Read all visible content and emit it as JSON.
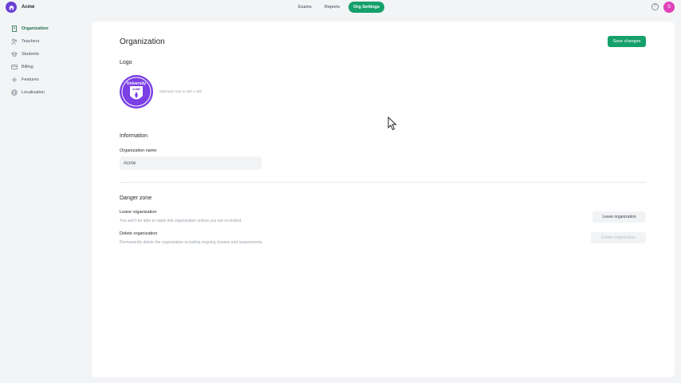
{
  "topbar": {
    "org_name": "Acme",
    "tabs": [
      {
        "label": "Exams"
      },
      {
        "label": "Reports"
      },
      {
        "label": "Org Settings",
        "active": true
      }
    ],
    "help_icon": "help-circle-icon",
    "avatar_initial": "S",
    "avatar_color": "#e040b8",
    "accent_color": "#16a06b"
  },
  "sidebar": {
    "items": [
      {
        "label": "Organization",
        "icon": "building-icon",
        "active": true
      },
      {
        "label": "Teachers",
        "icon": "users-icon"
      },
      {
        "label": "Students",
        "icon": "graduation-cap-icon"
      },
      {
        "label": "Billing",
        "icon": "credit-card-icon"
      },
      {
        "label": "Features",
        "icon": "sparkles-icon"
      },
      {
        "label": "Localization",
        "icon": "globe-icon"
      }
    ]
  },
  "main": {
    "title": "Organization",
    "save_label": "Save changes",
    "logo": {
      "heading": "Logo",
      "badge_top": "University",
      "badge_shield": "ACME",
      "hint": "Minimum size is 400 x 400"
    },
    "information": {
      "heading": "Information",
      "name_label": "Organization name",
      "name_value": "Acme"
    },
    "danger": {
      "heading": "Danger zone",
      "leave_title": "Leave organization",
      "leave_desc": "You won't be able to rejoin this organization unless you are re-invited.",
      "leave_button": "Leave organization",
      "delete_title": "Delete organization",
      "delete_desc": "Permanently delete the organization including ongoing classes and assessments.",
      "delete_button": "Delete organization"
    }
  }
}
